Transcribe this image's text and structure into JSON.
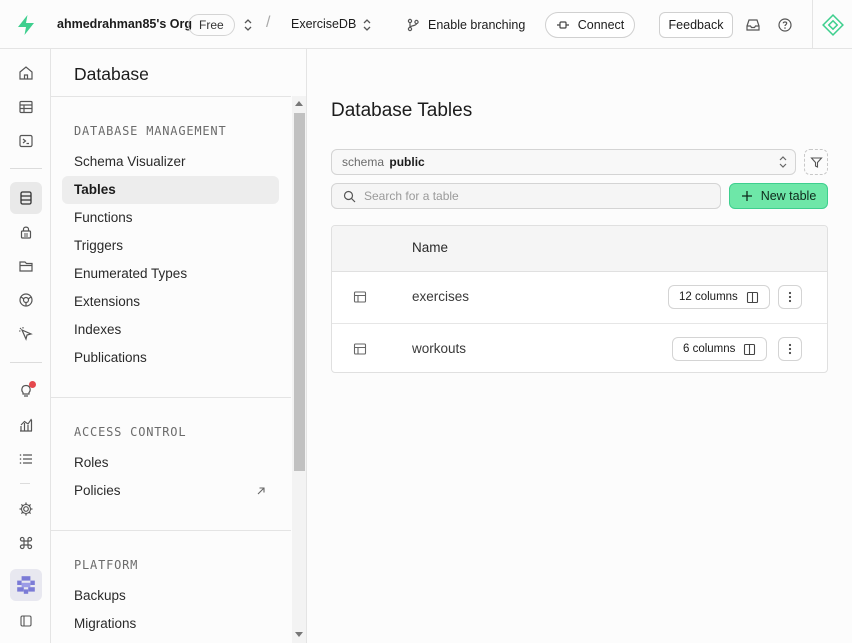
{
  "topbar": {
    "org_name": "ahmedrahman85's Org",
    "plan_badge": "Free",
    "separator": "/",
    "project_name": "ExerciseDB",
    "branch_label": "Enable branching",
    "connect_label": "Connect",
    "feedback_label": "Feedback"
  },
  "sidebar": {
    "title": "Database",
    "sections": [
      {
        "title": "DATABASE MANAGEMENT",
        "items": [
          "Schema Visualizer",
          "Tables",
          "Functions",
          "Triggers",
          "Enumerated Types",
          "Extensions",
          "Indexes",
          "Publications"
        ]
      },
      {
        "title": "ACCESS CONTROL",
        "items": [
          "Roles",
          "Policies"
        ]
      },
      {
        "title": "PLATFORM",
        "items": [
          "Backups",
          "Migrations"
        ]
      }
    ],
    "active_item": "Tables"
  },
  "main": {
    "title": "Database Tables",
    "schema_key": "schema",
    "schema_value": "public",
    "search_placeholder": "Search for a table",
    "new_table_label": "New table",
    "column_header": "Name",
    "rows": [
      {
        "name": "exercises",
        "columns": "12 columns"
      },
      {
        "name": "workouts",
        "columns": "6 columns"
      }
    ]
  },
  "colors": {
    "brand_green": "#3ecf8e",
    "new_table_bg": "#6ee7a8",
    "notification": "#e5484d"
  }
}
